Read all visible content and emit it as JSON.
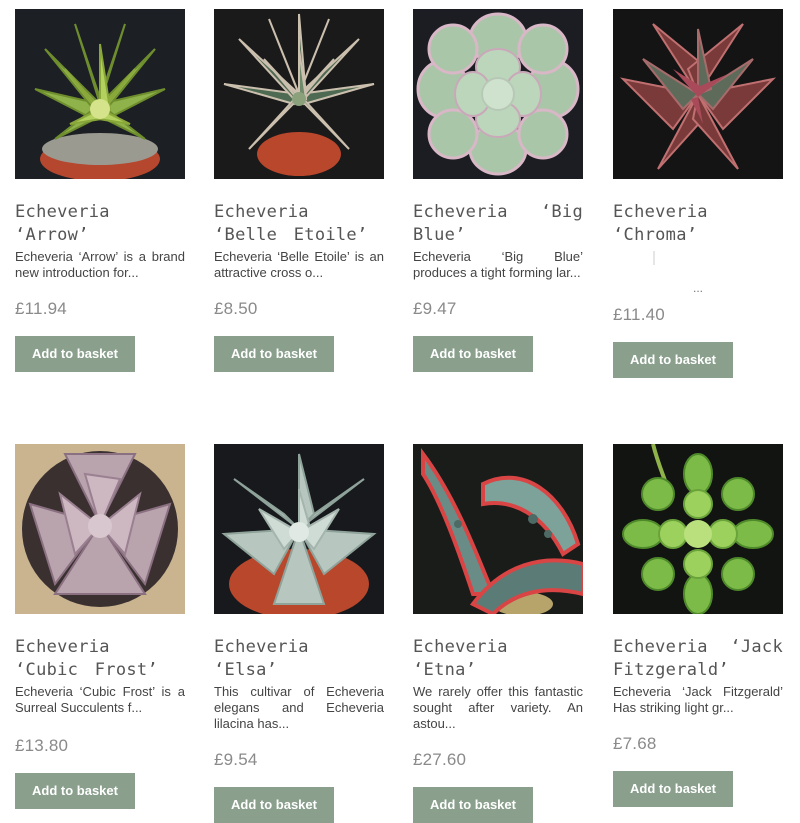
{
  "products": [
    {
      "title": "Echeveria ‘Arrow’",
      "description": "Echeveria ‘Arrow’ is a brand new introduction for...",
      "price": "£11.94",
      "button": "Add to basket"
    },
    {
      "title": "Echeveria ‘Belle Etoile’",
      "description": "Echeveria ‘Belle Etoile’ is an attractive cross o...",
      "price": "£8.50",
      "button": "Add to basket"
    },
    {
      "title": "Echeveria ‘Big Blue’",
      "description": "Echeveria ‘Big Blue’ produces a tight forming lar...",
      "price": "£9.47",
      "button": "Add to basket"
    },
    {
      "title": "Echeveria ‘Chroma’",
      "description": "...",
      "price": "£11.40",
      "button": "Add to basket"
    },
    {
      "title": "Echeveria ‘Cubic Frost’",
      "description": "Echeveria ‘Cubic Frost’ is a Surreal Succulents f...",
      "price": "£13.80",
      "button": "Add to basket"
    },
    {
      "title": "Echeveria ‘Elsa’",
      "description": "This cultivar of Echeveria elegans and Echeveria lilacina has...",
      "price": "£9.54",
      "button": "Add to basket"
    },
    {
      "title": "Echeveria ‘Etna’",
      "description": "We rarely offer this fantastic sought after variety. An astou...",
      "price": "£27.60",
      "button": "Add to basket"
    },
    {
      "title": "Echeveria ‘Jack Fitzgerald’",
      "description": "Echeveria ‘Jack Fitzgerald’ Has striking light gr...",
      "price": "£7.68",
      "button": "Add to basket"
    }
  ],
  "colors": {
    "button": "#8aa08d",
    "price": "#8a8a8a",
    "title": "#555555"
  },
  "images": [
    "green-rosette-succulent",
    "spiky-dark-rosette-succulent",
    "pale-blue-rosette-succulent",
    "red-purple-rosette-succulent",
    "lilac-frosted-rosette-succulent",
    "pale-green-rosette-succulent",
    "red-edged-aloe-like-succulent",
    "bright-green-rosette-succulent"
  ]
}
